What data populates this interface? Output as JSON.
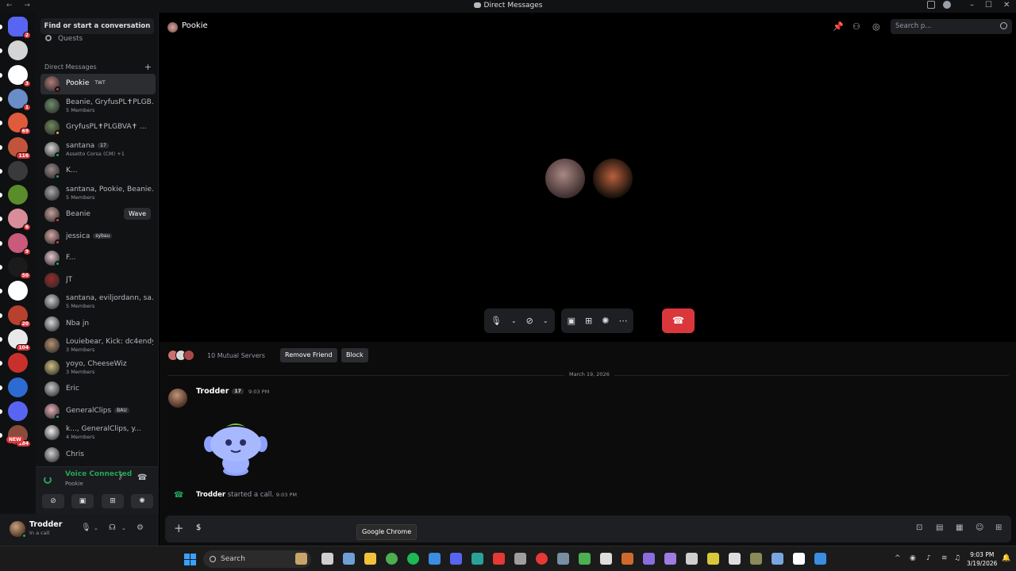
{
  "window": {
    "title": "Direct Messages"
  },
  "servers": [
    {
      "badge": "2",
      "color": "#5865f2"
    },
    {
      "badge": "",
      "color": "#d4d4d4"
    },
    {
      "badge": "3",
      "color": "#ffffff"
    },
    {
      "badge": "1",
      "color": "#6a8cc7"
    },
    {
      "badge": "69",
      "color": "#e05a3c"
    },
    {
      "badge": "116",
      "color": "#c2543b"
    },
    {
      "badge": "",
      "color": "#3a3a3a"
    },
    {
      "badge": "",
      "color": "#5a8c2b"
    },
    {
      "badge": "6",
      "color": "#d98c9a"
    },
    {
      "badge": "9",
      "color": "#c95a7c"
    },
    {
      "badge": "50",
      "color": "#1b1b1b"
    },
    {
      "badge": "",
      "color": "#ffffff"
    },
    {
      "badge": "20",
      "color": "#b8402e"
    },
    {
      "badge": "104",
      "color": "#e8e8e8"
    },
    {
      "badge": "",
      "color": "#c9302c"
    },
    {
      "badge": "",
      "color": "#2d6bd3"
    },
    {
      "badge": "",
      "color": "#5865f2"
    },
    {
      "badge": "184",
      "color": "#8a4b3c"
    }
  ],
  "servers_new": "NEW",
  "dm": {
    "find_placeholder": "Find or start a conversation",
    "quests": "Quests",
    "header": "Direct Messages",
    "items": [
      {
        "name": "Pookie",
        "tag": "TWT",
        "sub": "",
        "status": "#da373c",
        "avatar": "#b47c78"
      },
      {
        "name": "Beanie, GryfusPL✝PLGB...",
        "tag": "",
        "sub": "5 Members",
        "status": "",
        "avatar": "#6d8d6a"
      },
      {
        "name": "GryfusPL✝PLGBVA✝ ...",
        "tag": "",
        "sub": "",
        "status": "#f0b232",
        "avatar": "#6f8a5c"
      },
      {
        "name": "santana",
        "tag": "17",
        "sub": "Assetto Corsa (CM) +1",
        "status": "#23a55a",
        "avatar": "#d8d8d8"
      },
      {
        "name": "K...",
        "tag": "",
        "sub": "",
        "status": "#23a55a",
        "avatar": "#9a8a8a"
      },
      {
        "name": "santana, Pookie, Beanie...",
        "tag": "",
        "sub": "5 Members",
        "status": "",
        "avatar": "#aaaaaa"
      },
      {
        "name": "Beanie",
        "tag": "",
        "sub": "",
        "status": "#da373c",
        "avatar": "#c7a09c"
      },
      {
        "name": "jessica",
        "tag": "sybau",
        "sub": "",
        "status": "#da373c",
        "avatar": "#d8a8a4"
      },
      {
        "name": "F...",
        "tag": "",
        "sub": "",
        "status": "#23a55a",
        "avatar": "#e8c8d0"
      },
      {
        "name": "JT",
        "tag": "",
        "sub": "",
        "status": "",
        "avatar": "#9a2a2a"
      },
      {
        "name": "santana, eviljordann, sa...",
        "tag": "",
        "sub": "5 Members",
        "status": "",
        "avatar": "#cfcfcf"
      },
      {
        "name": "Nba jn",
        "tag": "",
        "sub": "",
        "status": "",
        "avatar": "#d8d8d8"
      },
      {
        "name": "Louiebear, Kick: dc4endy",
        "tag": "",
        "sub": "3 Members",
        "status": "",
        "avatar": "#b89070"
      },
      {
        "name": "yoyo, CheeseWiz",
        "tag": "",
        "sub": "3 Members",
        "status": "",
        "avatar": "#d0c080"
      },
      {
        "name": "Eric",
        "tag": "",
        "sub": "",
        "status": "",
        "avatar": "#c8c8c8"
      },
      {
        "name": "GeneralClips",
        "tag": "BAU",
        "sub": "",
        "status": "#23a55a",
        "avatar": "#e8b0b8"
      },
      {
        "name": "k..., GeneralClips, y...",
        "tag": "",
        "sub": "4 Members",
        "status": "",
        "avatar": "#f0f0f0"
      },
      {
        "name": "Chris",
        "tag": "",
        "sub": "",
        "status": "",
        "avatar": "#d0d0d0"
      }
    ],
    "wave_label": "Wave"
  },
  "voice": {
    "status": "Voice Connected",
    "channel": "Pookie"
  },
  "user": {
    "name": "Trodder",
    "status": "In a call"
  },
  "chat_header": {
    "title": "Pookie",
    "search_placeholder": "Search p..."
  },
  "chat": {
    "mutual_servers": "10 Mutual Servers",
    "remove_friend": "Remove Friend",
    "block": "Block",
    "date_divider": "March 19, 2026",
    "message": {
      "author": "Trodder",
      "tag": "17",
      "time": "9:03 PM"
    },
    "call_event": {
      "author": "Trodder",
      "text": "started a call.",
      "time": "9:03 PM"
    },
    "composer_value": "$"
  },
  "tooltip": "Google Chrome",
  "taskbar": {
    "search": "Search",
    "time": "9:03 PM",
    "date": "3/19/2026"
  }
}
